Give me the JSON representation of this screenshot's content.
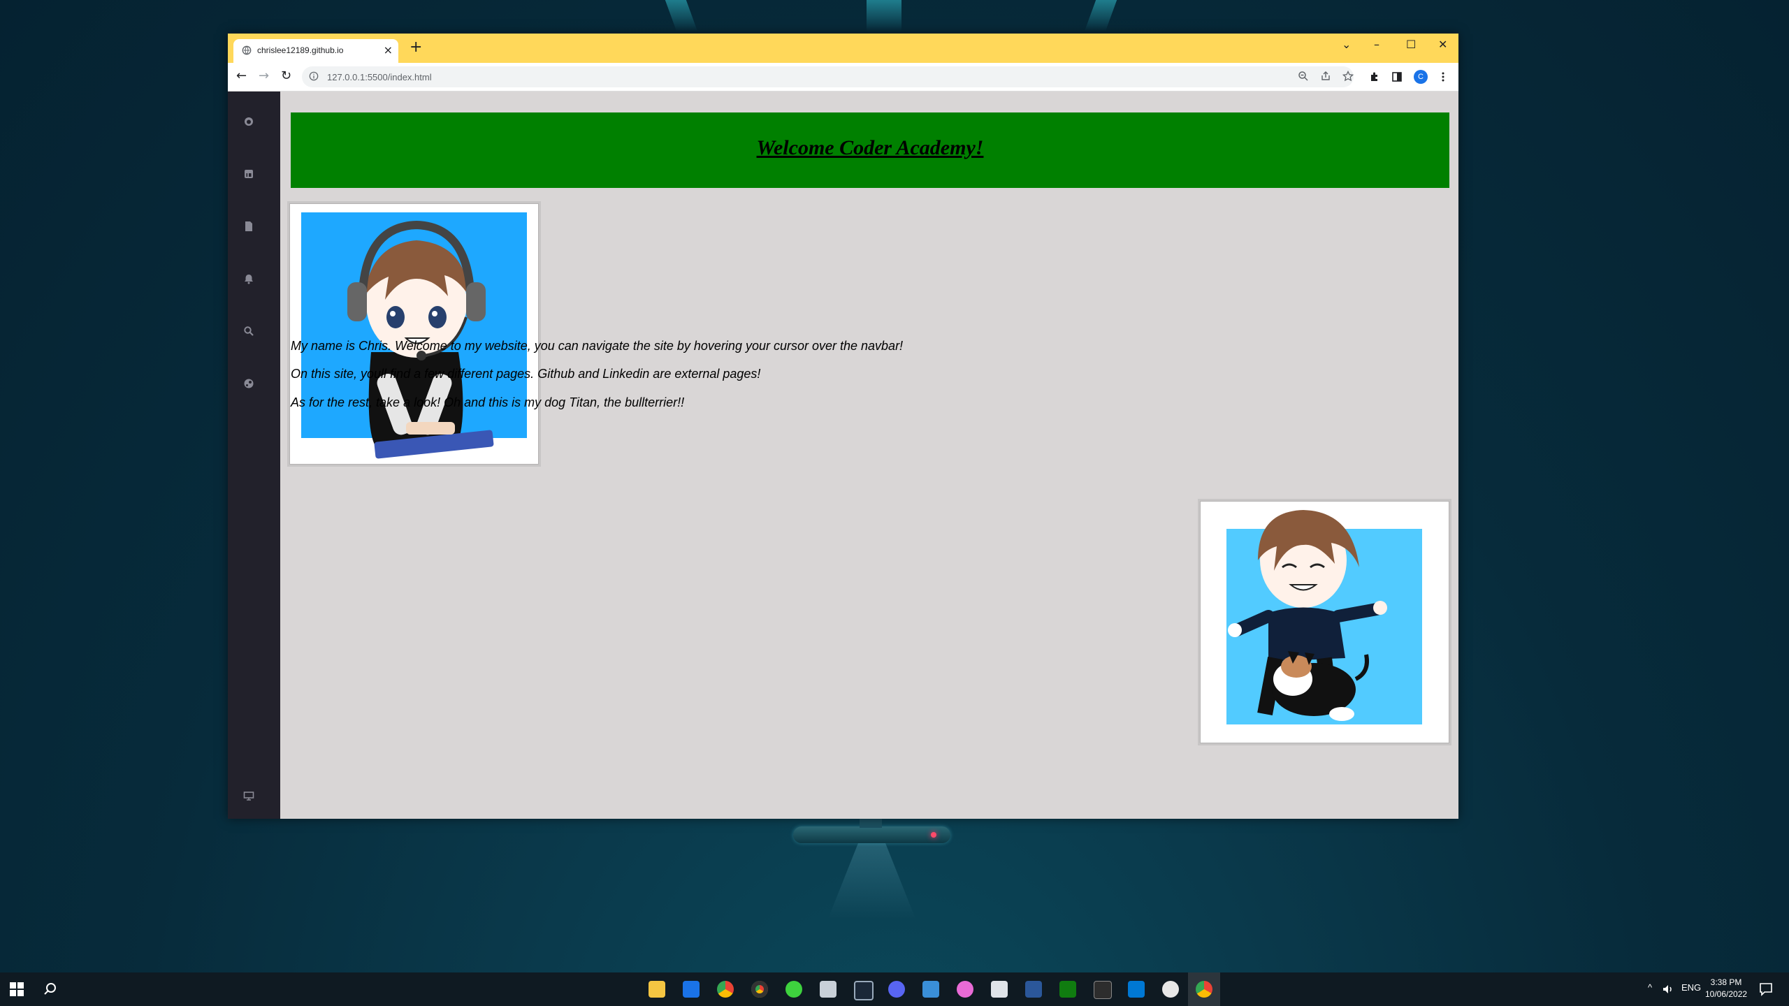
{
  "browser": {
    "tab_title": "chrislee12189.github.io",
    "tab_close": "×",
    "new_tab": "+",
    "url": "127.0.0.1:5500/index.html",
    "profile_initial": "C",
    "controls": {
      "dropdown": "⌄",
      "minimize": "–",
      "maximize": "☐",
      "close": "✕"
    },
    "nav": {
      "back": "←",
      "forward": "→",
      "reload": "↻"
    }
  },
  "page": {
    "banner_title": "Welcome Coder Academy!",
    "paragraphs": [
      "My name is Chris. Welcome to my website, you can navigate the site by hovering your cursor over the navbar!",
      "On this site, youll find a few different pages. Github and Linkedin are external pages!",
      "As for the rest, take a look! Oh and this is my dog Titan, the bullterrier!!"
    ],
    "sidebar_icons": [
      "github-icon",
      "linkedin-icon",
      "document-icon",
      "bell-icon",
      "search-icon",
      "steam-icon",
      "monitor-icon"
    ]
  },
  "taskbar": {
    "language": "ENG",
    "time": "3:38 PM",
    "date": "10/06/2022"
  }
}
